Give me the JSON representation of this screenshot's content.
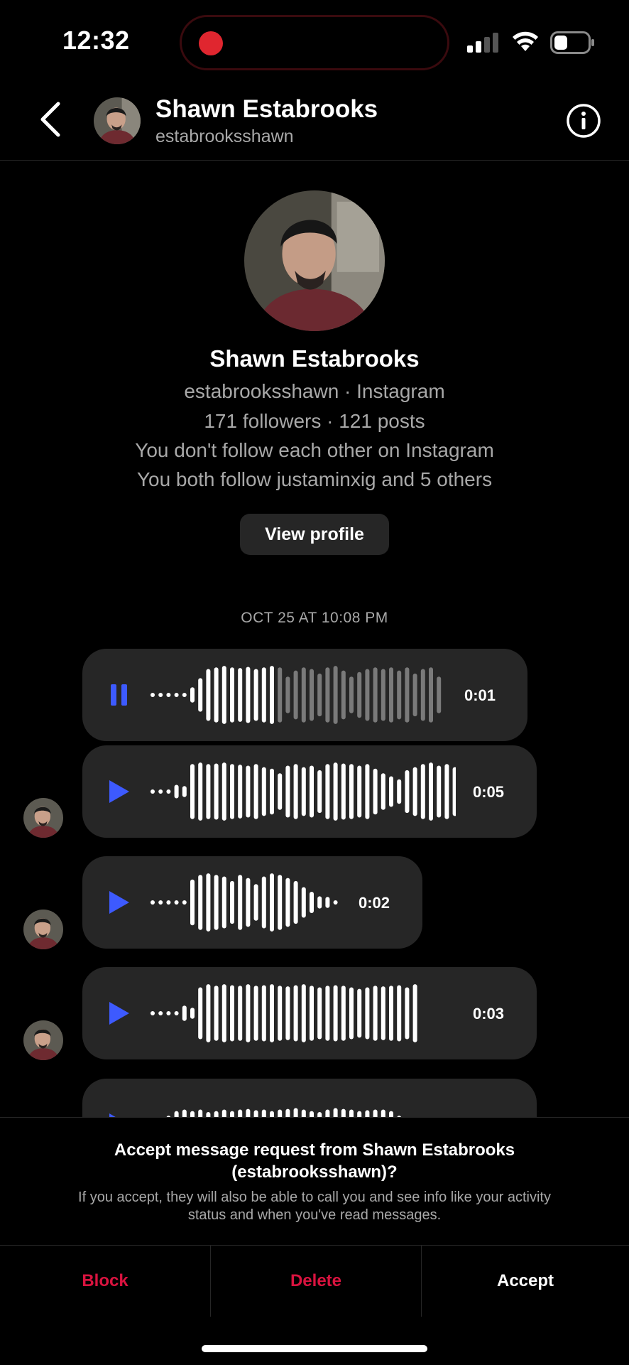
{
  "status_bar": {
    "time": "12:32"
  },
  "header": {
    "name": "Shawn Estabrooks",
    "username": "estabrooksshawn"
  },
  "profile": {
    "name": "Shawn Estabrooks",
    "username_line": "estabrooksshawn · Instagram",
    "stats": "171 followers · 121 posts",
    "relationship": "You don't follow each other on Instagram",
    "mutuals": "You both follow justaminxig and 5 others",
    "view_profile_label": "View profile"
  },
  "thread": {
    "timestamp": "OCT 25 AT 10:08 PM",
    "messages": [
      {
        "type": "voice",
        "duration": "0:01",
        "state": "playing",
        "played_fraction": 0.4
      },
      {
        "type": "voice",
        "duration": "0:05",
        "state": "paused"
      },
      {
        "type": "voice",
        "duration": "0:02",
        "state": "paused"
      },
      {
        "type": "voice",
        "duration": "0:03",
        "state": "paused"
      },
      {
        "type": "voice",
        "duration": "",
        "state": "paused"
      }
    ]
  },
  "request": {
    "title_line1": "Accept message request from Shawn Estabrooks",
    "title_line2": "(estabrooksshawn)?",
    "desc_line1": "If you accept, they will also be able to call you and see info like your activity",
    "desc_line2": "status and when you've read messages.",
    "block_label": "Block",
    "delete_label": "Delete",
    "accept_label": "Accept"
  },
  "colors": {
    "background": "#000000",
    "bubble": "#262626",
    "play_accent": "#3d5afe",
    "destructive": "#d9133f",
    "secondary_text": "#a8a8a8"
  }
}
